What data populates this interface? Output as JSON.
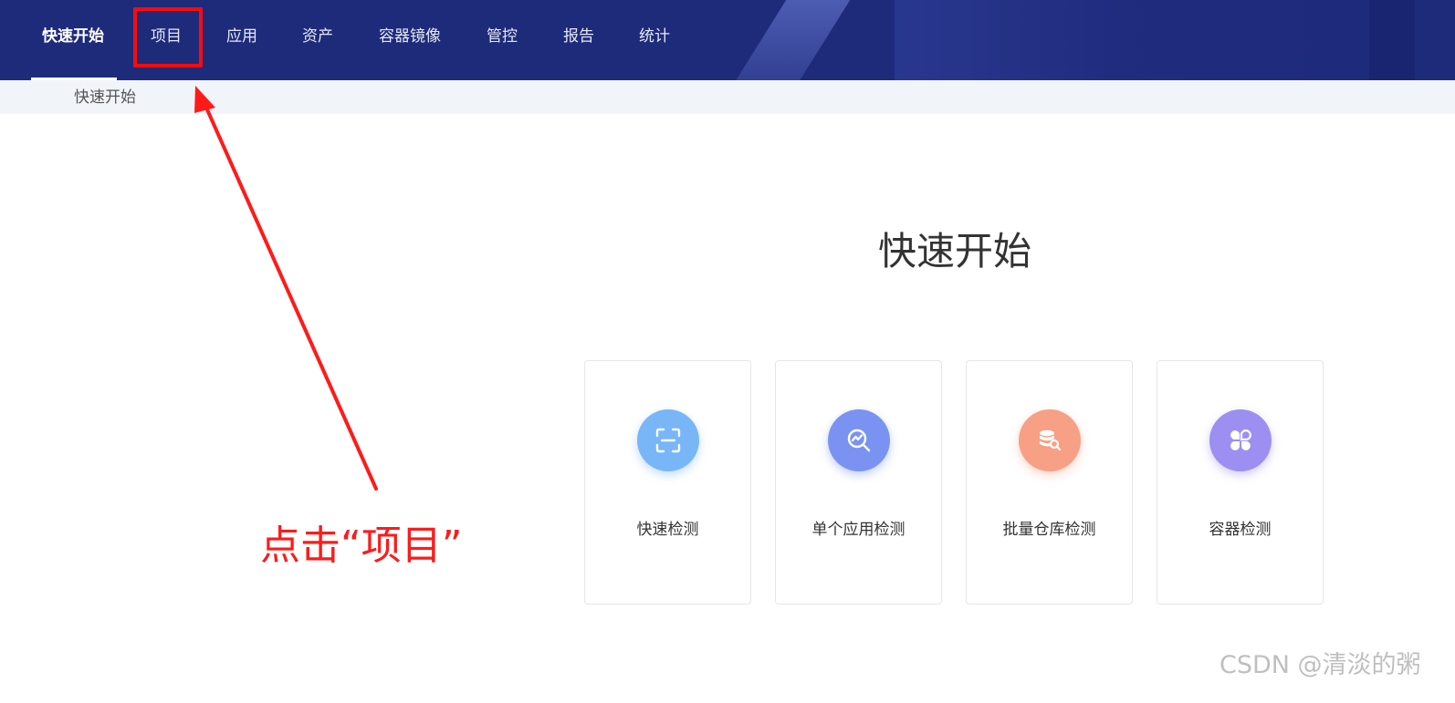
{
  "nav": {
    "items": [
      {
        "label": "快速开始",
        "active": true
      },
      {
        "label": "项目",
        "active": false
      },
      {
        "label": "应用",
        "active": false
      },
      {
        "label": "资产",
        "active": false
      },
      {
        "label": "容器镜像",
        "active": false
      },
      {
        "label": "管控",
        "active": false
      },
      {
        "label": "报告",
        "active": false
      },
      {
        "label": "统计",
        "active": false
      }
    ],
    "background": "#1e2a7a"
  },
  "breadcrumb": {
    "label": "快速开始"
  },
  "main": {
    "title": "快速开始",
    "cards": [
      {
        "label": "快速检测",
        "icon": "scan-icon",
        "color": "#79b6f8"
      },
      {
        "label": "单个应用检测",
        "icon": "search-chart-icon",
        "color": "#7a93f2"
      },
      {
        "label": "批量仓库检测",
        "icon": "database-search-icon",
        "color": "#f7a085"
      },
      {
        "label": "容器检测",
        "icon": "clover-icon",
        "color": "#9d8ff1"
      }
    ]
  },
  "annotation": {
    "text": "点击“项目”",
    "color": "#ff1a1a"
  },
  "watermark": {
    "text": "CSDN @清淡的粥"
  }
}
